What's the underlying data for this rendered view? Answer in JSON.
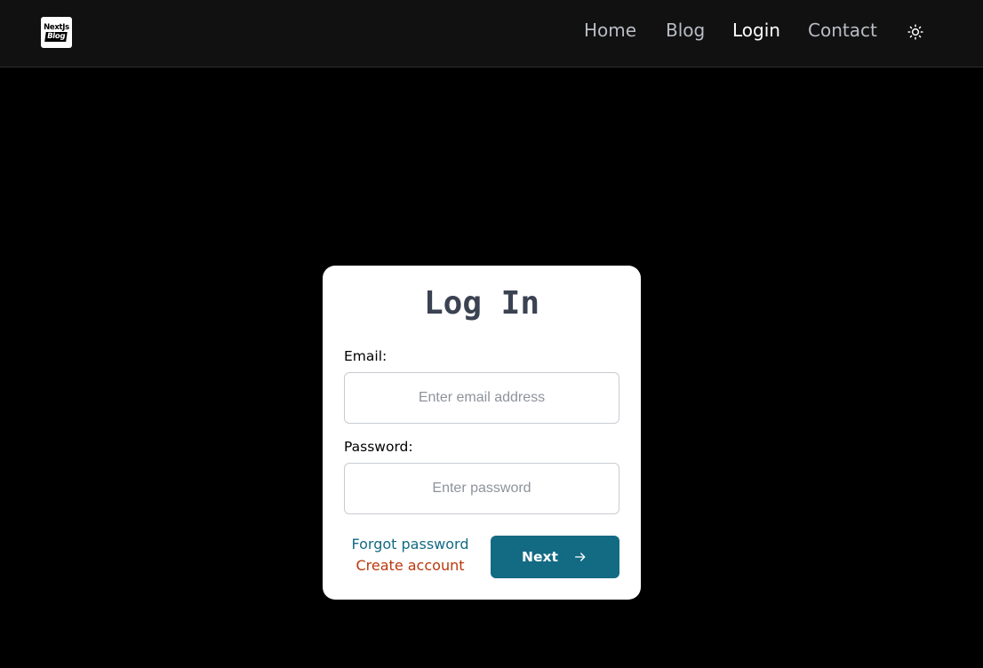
{
  "header": {
    "logo": {
      "line1": "NextJs",
      "line2": "Blog"
    },
    "nav": [
      {
        "label": "Home",
        "active": false
      },
      {
        "label": "Blog",
        "active": false
      },
      {
        "label": "Login",
        "active": true
      },
      {
        "label": "Contact",
        "active": false
      }
    ],
    "theme_toggle_icon": "sun-icon"
  },
  "login": {
    "title": "Log In",
    "email": {
      "label": "Email:",
      "placeholder": "Enter email address",
      "value": ""
    },
    "password": {
      "label": "Password:",
      "placeholder": "Enter password",
      "value": ""
    },
    "forgot_password": "Forgot password",
    "create_account": "Create account",
    "next_button": {
      "label": "Next",
      "icon": "arrow-right-icon"
    }
  },
  "colors": {
    "page_background": "#000000",
    "navbar_background": "#111111",
    "accent": "#136a83",
    "create_account_link": "#b9380b",
    "title_text": "#3b4252"
  }
}
